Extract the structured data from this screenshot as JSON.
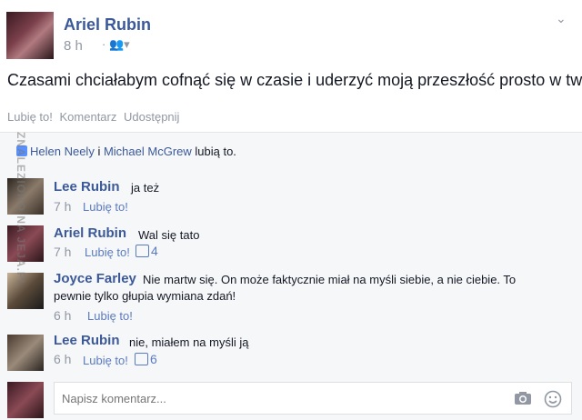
{
  "post": {
    "author": "Ariel Rubin",
    "time": "8 h",
    "privacy_icon": "friends-icon",
    "text": "Czasami chciałabym cofnąć się w czasie i uderzyć moją przeszłość prosto w twarz."
  },
  "actions": {
    "like": "Lubię to!",
    "comment": "Komentarz",
    "share": "Udostępnij"
  },
  "likes": {
    "user1": "Helen Neely",
    "and": "i",
    "user2": "Michael McGrew",
    "suffix": "lubią to."
  },
  "comments": [
    {
      "name": "Lee Rubin",
      "text": "ja też",
      "time": "7 h",
      "like": "Lubię to!",
      "count": ""
    },
    {
      "name": "Ariel Rubin",
      "text": "Wal się tato",
      "time": "7 h",
      "like": "Lubię to!",
      "count": "4"
    },
    {
      "name": "Joyce Farley",
      "text": "Nie martw się. On może faktycznie miał na myśli siebie, a nie ciebie. To pewnie tylko głupia wymiana zdań!",
      "time": "6 h",
      "like": "Lubię to!",
      "count": ""
    },
    {
      "name": "Lee Rubin",
      "text": "nie, miałem na myśli ją",
      "time": "6 h",
      "like": "Lubię to!",
      "count": "6"
    }
  ],
  "composer": {
    "placeholder": "Napisz komentarz..."
  },
  "watermark": "ZNALEZIONO NA JEJA.PL",
  "colors": {
    "link": "#3b5998",
    "muted": "#9197a3",
    "background_comments": "#f6f7f9"
  }
}
